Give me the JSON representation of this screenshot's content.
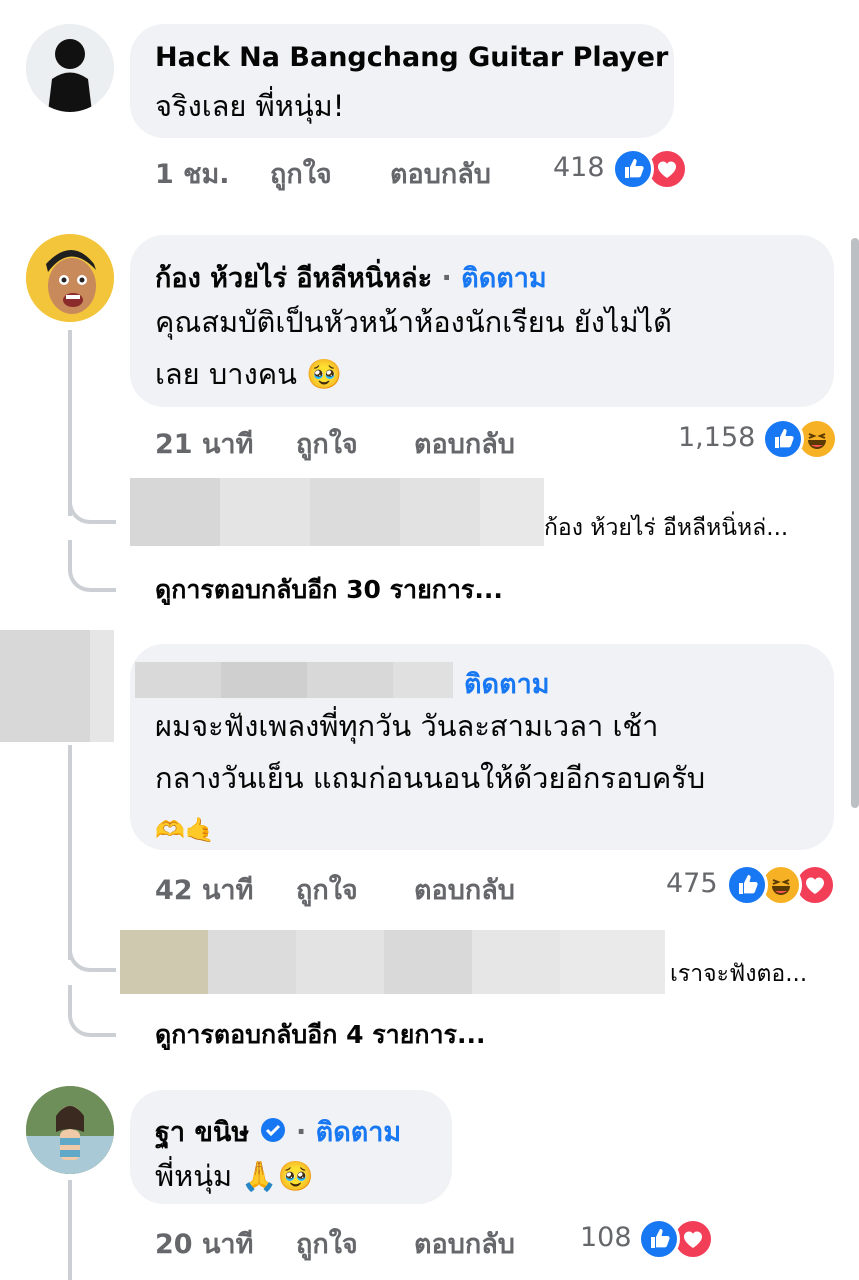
{
  "colors": {
    "accent": "#1877f2",
    "meta": "#65676b",
    "bubble": "#f0f2f5",
    "love": "#f33e58",
    "haha": "#f7b125"
  },
  "comments": [
    {
      "name": "Hack Na Bangchang Guitar Player",
      "text": "จริงเลย พี่หนุ่ม!",
      "time": "1 ชม.",
      "like": "ถูกใจ",
      "reply": "ตอบกลับ",
      "reaction_count": "418",
      "reactions": [
        "like-icon",
        "love-icon"
      ]
    },
    {
      "name": "ก้อง ห้วยไร่ อีหลีหนิ่หล่ะ",
      "follow": "ติดตาม",
      "separator": "·",
      "text_line1": "คุณสมบัติเป็นหัวหน้าห้องนักเรียน ยังไม่ได้",
      "text_line2": "เลย บางคน",
      "emoji": "🥹",
      "time": "21 นาที",
      "like": "ถูกใจ",
      "reply": "ตอบกลับ",
      "reaction_count": "1,158",
      "reactions": [
        "like-icon",
        "haha-icon"
      ],
      "reply_preview": "ก้อง ห้วยไร่ อีหลีหนิ่หล่...",
      "more_replies": "ดูการตอบกลับอีก 30 รายการ..."
    },
    {
      "follow": "ติดตาม",
      "text_line1": "ผมจะฟังเพลงพี่ทุกวัน วันละสามเวลา เช้า",
      "text_line2": "กลางวันเย็น แถมก่อนนอนให้ด้วยอีกรอบครับ",
      "emoji": "🫶🤙",
      "time": "42 นาที",
      "like": "ถูกใจ",
      "reply": "ตอบกลับ",
      "reaction_count": "475",
      "reactions": [
        "like-icon",
        "haha-icon",
        "love-icon"
      ],
      "reply_preview": "เราจะฟังตอ...",
      "more_replies": "ดูการตอบกลับอีก 4 รายการ..."
    },
    {
      "name": "ฐา ขนิษ",
      "verified": "verified-badge-icon",
      "separator": "·",
      "follow": "ติดตาม",
      "text": "พี่หนุ่ม",
      "emoji": "🙏🥹",
      "time": "20 นาที",
      "like": "ถูกใจ",
      "reply": "ตอบกลับ",
      "reaction_count": "108",
      "reactions": [
        "like-icon",
        "love-icon"
      ]
    }
  ]
}
